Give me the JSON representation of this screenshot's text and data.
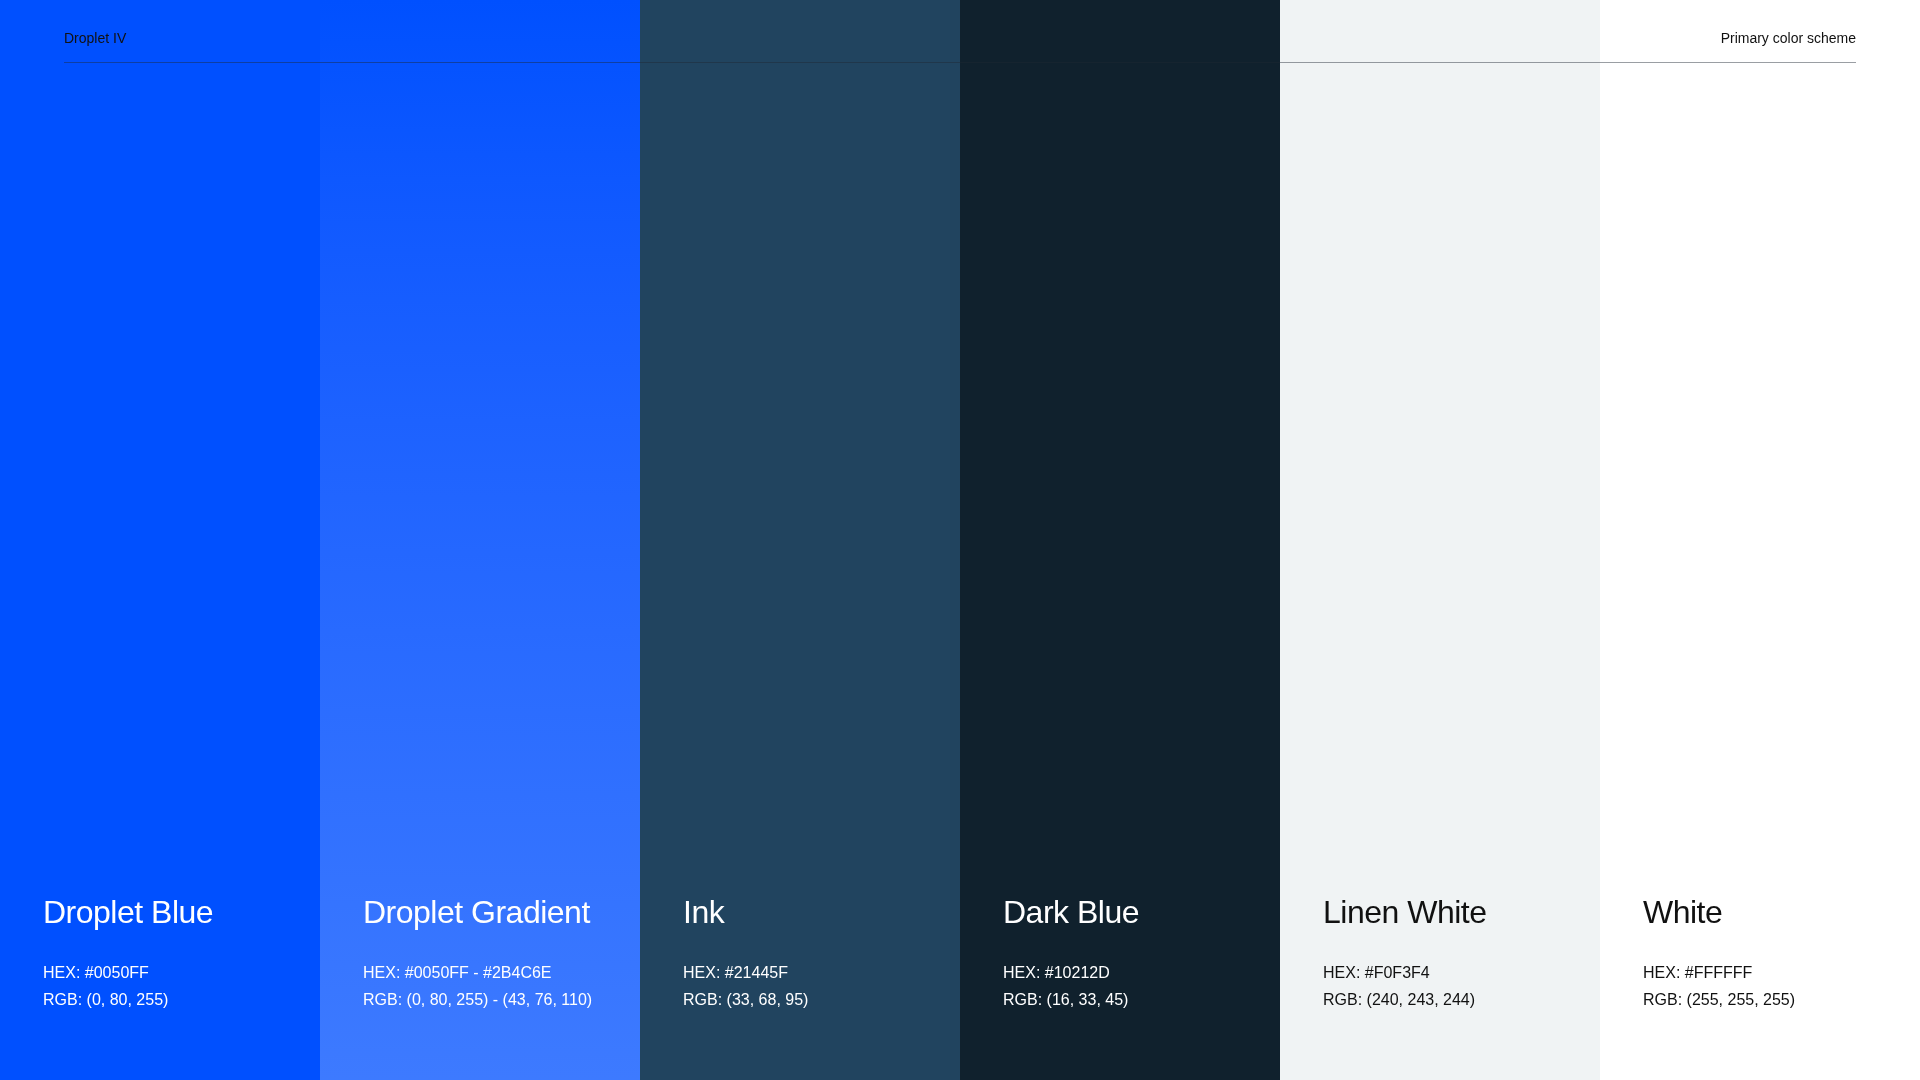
{
  "header": {
    "title": "Droplet IV",
    "subtitle": "Primary color scheme"
  },
  "swatches": [
    {
      "name": "Droplet Blue",
      "hex": "HEX: #0050FF",
      "rgb": "RGB: (0, 80, 255)",
      "color": "#0050ff"
    },
    {
      "name": "Droplet Gradient",
      "hex": "HEX: #0050FF - #2B4C6E",
      "rgb": "RGB: (0, 80, 255) - (43, 76, 110)",
      "color": "#0050ff",
      "kind": "gradient"
    },
    {
      "name": "Ink",
      "hex": "HEX: #21445F",
      "rgb": "RGB: (33, 68, 95)",
      "color": "#21445f"
    },
    {
      "name": "Dark Blue",
      "hex": "HEX: #10212D",
      "rgb": "RGB: (16, 33, 45)",
      "color": "#10212d"
    },
    {
      "name": "Linen White",
      "hex": "HEX: #F0F3F4",
      "rgb": "RGB: (240, 243, 244)",
      "color": "#f0f3f4"
    },
    {
      "name": "White",
      "hex": "HEX: #FFFFFF",
      "rgb": "RGB: (255, 255, 255)",
      "color": "#ffffff"
    }
  ]
}
